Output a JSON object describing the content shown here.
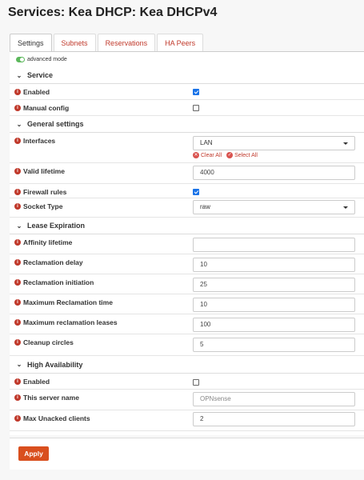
{
  "page": {
    "title": "Services: Kea DHCP: Kea DHCPv4"
  },
  "tabs": [
    "Settings",
    "Subnets",
    "Reservations",
    "HA Peers"
  ],
  "advanced_mode": {
    "label": "advanced mode",
    "enabled": true
  },
  "sections": {
    "service": "Service",
    "general": "General settings",
    "lease": "Lease Expiration",
    "ha": "High Availability"
  },
  "fields": {
    "enabled": {
      "label": "Enabled",
      "checked": true
    },
    "manual_config": {
      "label": "Manual config",
      "checked": false
    },
    "interfaces": {
      "label": "Interfaces",
      "value": "LAN",
      "clear_all": "Clear All",
      "select_all": "Select All"
    },
    "valid_lifetime": {
      "label": "Valid lifetime",
      "value": "4000"
    },
    "firewall_rules": {
      "label": "Firewall rules",
      "checked": true
    },
    "socket_type": {
      "label": "Socket Type",
      "value": "raw"
    },
    "affinity_lifetime": {
      "label": "Affinity lifetime",
      "value": ""
    },
    "reclamation_delay": {
      "label": "Reclamation delay",
      "value": "10"
    },
    "reclamation_initiation": {
      "label": "Reclamation initiation",
      "value": "25"
    },
    "max_reclamation_time": {
      "label": "Maximum Reclamation time",
      "value": "10"
    },
    "max_reclamation_leases": {
      "label": "Maximum reclamation leases",
      "value": "100"
    },
    "cleanup_circles": {
      "label": "Cleanup circles",
      "value": "5"
    },
    "ha_enabled": {
      "label": "Enabled",
      "checked": false
    },
    "server_name": {
      "label": "This server name",
      "placeholder": "OPNsense"
    },
    "max_unacked": {
      "label": "Max Unacked clients",
      "value": "2"
    }
  },
  "actions": {
    "apply": "Apply"
  },
  "colors": {
    "accent": "#c0392b",
    "apply": "#d94f1e",
    "checkbox": "#1a73e8",
    "toggle": "#5cb85c"
  }
}
